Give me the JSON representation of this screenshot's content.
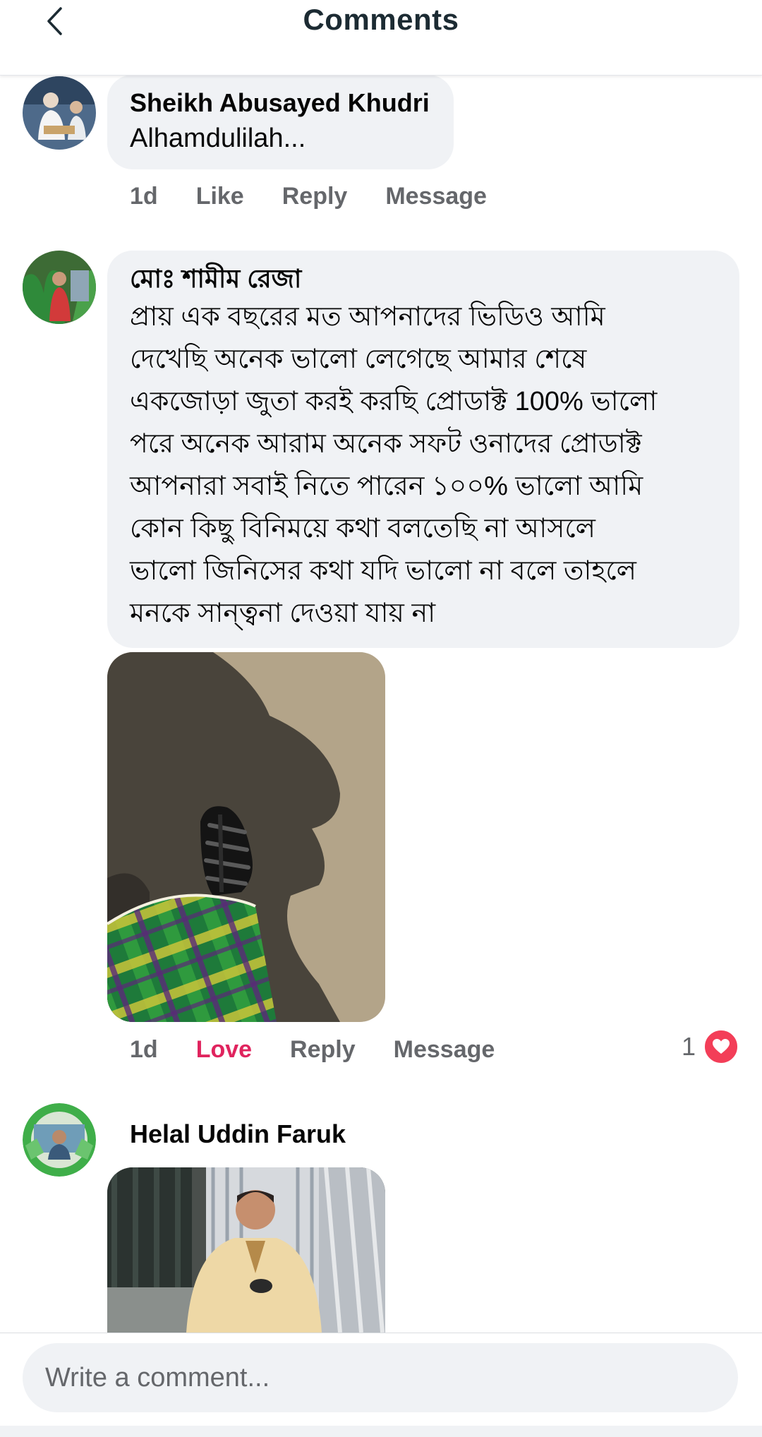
{
  "header": {
    "title": "Comments",
    "back_icon": "chevron-left-icon"
  },
  "comments": [
    {
      "author": "Sheikh Abusayed Khudri",
      "text": "Alhamdulilah...",
      "time": "1d",
      "like_label": "Like",
      "reply_label": "Reply",
      "message_label": "Message"
    },
    {
      "author": "মোঃ শামীম রেজা",
      "text_lines": [
        "প্রায় এক বছরের মত আপনাদের ভিডিও আমি",
        "দেখেছি অনেক ভালো লেগেছে আমার শেষে",
        "একজোড়া জুতা করই করছি প্রোডাক্ট 100% ভালো",
        "পরে অনেক আরাম অনেক সফট ওনাদের প্রোডাক্ট",
        "আপনারা সবাই নিতে পারেন ১০০% ভালো আমি",
        "কোন কিছু বিনিময়ে কথা বলতেছি না আসলে",
        "ভালো জিনিসের কথা যদি ভালো না বলে তাহলে",
        "মনকে সান্ত্বনা দেওয়া যায় না"
      ],
      "time": "1d",
      "love_label": "Love",
      "reply_label": "Reply",
      "message_label": "Message",
      "reaction_count": "1",
      "reaction_icon": "heart-icon",
      "reaction_color": "#f33e58"
    },
    {
      "author": "Helal Uddin Faruk"
    }
  ],
  "composer": {
    "placeholder": "Write a comment..."
  },
  "colors": {
    "bubble": "#f0f2f5",
    "meta": "#65676b",
    "love": "#e0245e"
  }
}
